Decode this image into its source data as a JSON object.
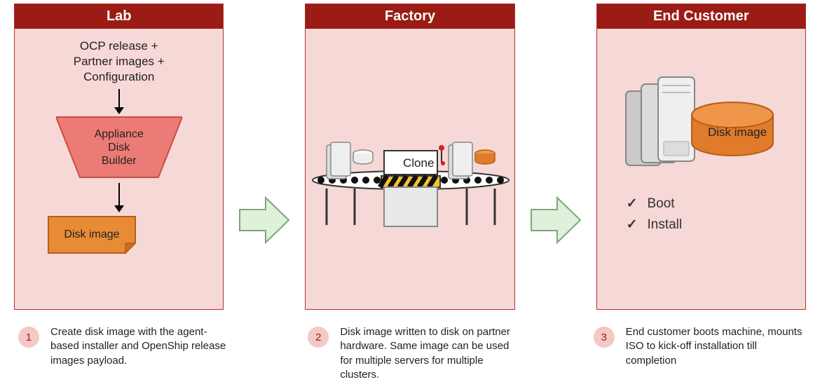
{
  "panels": {
    "lab": {
      "title": "Lab",
      "input_line1": "OCP release +",
      "input_line2": "Partner images +",
      "input_line3": "Configuration",
      "builder_line1": "Appliance",
      "builder_line2": "Disk",
      "builder_line3": "Builder",
      "disk_image_label": "Disk image"
    },
    "factory": {
      "title": "Factory",
      "clone_label": "Clone"
    },
    "end_customer": {
      "title": "End Customer",
      "disk_image_label": "Disk image",
      "checks": [
        "Boot",
        "Install"
      ]
    }
  },
  "captions": [
    {
      "num": "1",
      "text": "Create disk image with the agent-based installer and OpenShip release images payload."
    },
    {
      "num": "2",
      "text": "Disk image written to disk on partner hardware. Same image can be used for multiple servers for multiple clusters."
    },
    {
      "num": "3",
      "text": "End customer boots machine, mounts ISO to kick-off installation till completion"
    }
  ],
  "colors": {
    "header_bg": "#9a1c14",
    "panel_bg": "#f6d8d6",
    "orange": "#e07b2c",
    "orange_dark": "#c15d12",
    "red_fill": "#ec7b75",
    "arrow_fill": "#dff0db",
    "arrow_stroke": "#7ea77a"
  }
}
